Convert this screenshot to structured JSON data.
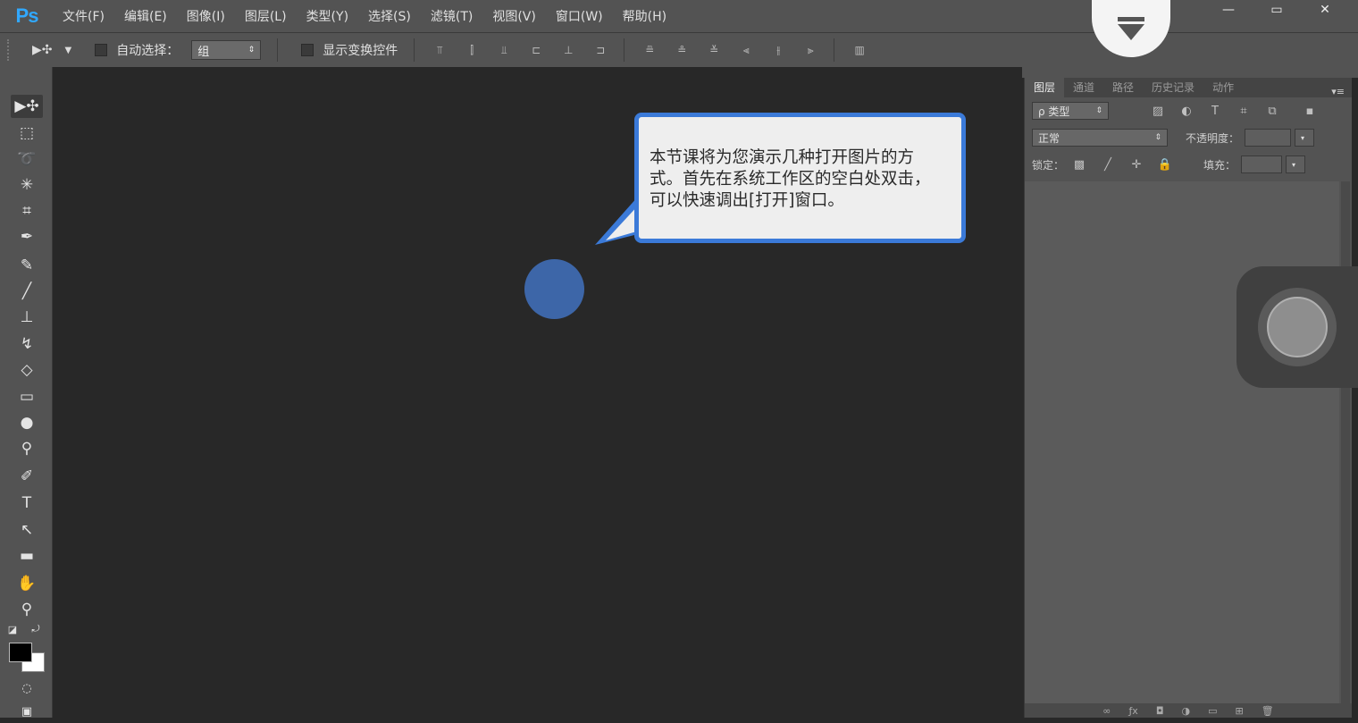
{
  "app": {
    "logo": "Ps"
  },
  "menu": [
    {
      "label": "文件(F)"
    },
    {
      "label": "编辑(E)"
    },
    {
      "label": "图像(I)"
    },
    {
      "label": "图层(L)"
    },
    {
      "label": "类型(Y)"
    },
    {
      "label": "选择(S)"
    },
    {
      "label": "滤镜(T)"
    },
    {
      "label": "视图(V)"
    },
    {
      "label": "窗口(W)"
    },
    {
      "label": "帮助(H)"
    }
  ],
  "window_controls": {
    "minimize": "—",
    "maximize": "▭",
    "close": "✕"
  },
  "options_bar": {
    "auto_select_label": "自动选择：",
    "auto_select_value": "组",
    "show_transform_label": "显示变换控件"
  },
  "layers_panel": {
    "tabs": [
      "图层",
      "通道",
      "路径",
      "历史记录",
      "动作"
    ],
    "filter_kind": "ρ 类型",
    "blend_mode": "正常",
    "opacity_label": "不透明度：",
    "lock_label": "锁定：",
    "fill_label": "填充："
  },
  "callout": {
    "text": "本节课将为您演示几种打开图片的方式。首先在系统工作区的空白处双击，可以快速调出[打开]窗口。"
  },
  "colors": {
    "accent_blue": "#3b7ad8",
    "cursor_dot": "#3d66a8",
    "ui_panel": "#535353",
    "workspace": "#282828"
  }
}
